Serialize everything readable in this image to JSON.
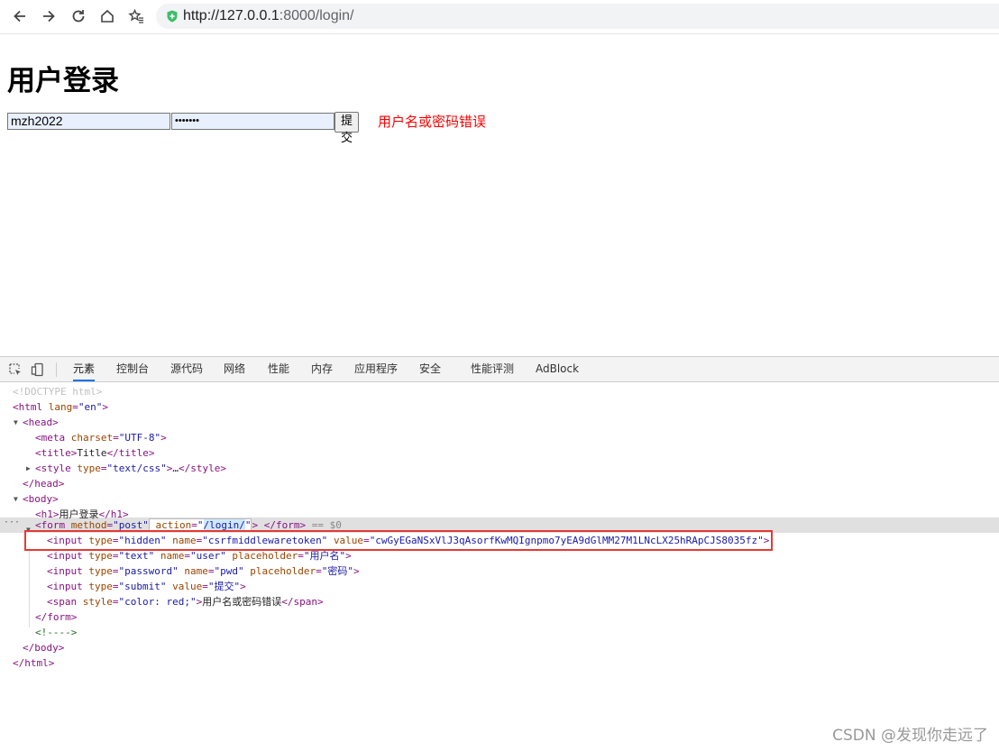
{
  "browser": {
    "url_host": "http://127.0.0.1",
    "url_rest": ":8000/login/"
  },
  "page": {
    "heading": "用户登录",
    "username_value": "mzh2022",
    "password_mask": "•••••••",
    "submit_label": "提交",
    "error_text": "用户名或密码错误",
    "error_color": "#ff0000"
  },
  "devtools": {
    "tabs": [
      "元素",
      "控制台",
      "源代码",
      "网络",
      "性能",
      "内存",
      "应用程序",
      "安全",
      "性能评测",
      "AdBlock"
    ],
    "active_tab": "元素",
    "lines": {
      "doctype": "<!DOCTYPE html>",
      "html_open_tag": "html",
      "html_lang_attr": "lang",
      "html_lang_val": "\"en\"",
      "head": "head",
      "meta": "meta",
      "meta_attr": "charset",
      "meta_val": "\"UTF-8\"",
      "title_tag": "title",
      "title_text": "Title",
      "style_tag": "style",
      "style_attr": "type",
      "style_val": "\"text/css\"",
      "ellipsis": "…",
      "body": "body",
      "h1_tag": "h1",
      "h1_text": "用户登录",
      "form_tag": "form",
      "form_method_attr": "method",
      "form_method_val": "\"post\"",
      "form_action_attr": "action",
      "form_action_val": "/login/",
      "form_eq": "== $0",
      "input_tag": "input",
      "type_attr": "type",
      "name_attr": "name",
      "value_attr": "value",
      "placeholder_attr": "placeholder",
      "style_attr2": "style",
      "hidden_type": "\"hidden\"",
      "hidden_name": "\"csrfmiddlewaretoken\"",
      "hidden_value": "\"cwGyEGaNSxVlJ3qAsorfKwMQIgnpmo7yEA9dGlMM27M1LNcLX25hRApCJS8035fz\"",
      "user_type": "\"text\"",
      "user_name": "\"user\"",
      "user_placeholder": "\"用户名\"",
      "pwd_type": "\"password\"",
      "pwd_name": "\"pwd\"",
      "pwd_placeholder": "\"密码\"",
      "submit_type": "\"submit\"",
      "submit_value": "\"提交\"",
      "span_tag": "span",
      "span_style_val": "\"color: red;\"",
      "span_text": "用户名或密码错误",
      "comment": "<!---->"
    }
  },
  "watermark": "CSDN @发现你走远了",
  "icons": [
    "back-arrow-icon",
    "forward-arrow-icon",
    "reload-icon",
    "home-icon",
    "favorites-star-icon",
    "shield-icon",
    "inspect-cursor-icon",
    "device-toolbar-icon"
  ]
}
